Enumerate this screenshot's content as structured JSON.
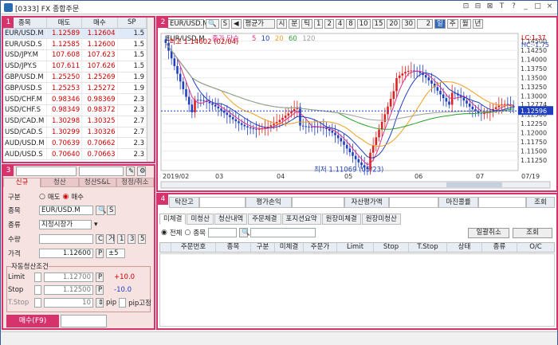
{
  "window": {
    "title": "[0333] FX 종합주문",
    "buttons": [
      "⊡",
      "⊟",
      "⊠",
      "T",
      "?",
      "_",
      "□",
      "×"
    ]
  },
  "panels": {
    "p1": "1",
    "p2": "2",
    "p3": "3",
    "p4": "4"
  },
  "quotes": {
    "headers": [
      "종목",
      "매도",
      "매수",
      "SP"
    ],
    "rows": [
      {
        "sym": "EUR/USD.M",
        "bid": "1.12589",
        "ask": "1.12604",
        "sp": "1.5"
      },
      {
        "sym": "EUR/USD.S",
        "bid": "1.12585",
        "ask": "1.12600",
        "sp": "1.5"
      },
      {
        "sym": "USD/JPY.M",
        "bid": "107.608",
        "ask": "107.623",
        "sp": "1.5"
      },
      {
        "sym": "USD/JPY.S",
        "bid": "107.611",
        "ask": "107.626",
        "sp": "1.5"
      },
      {
        "sym": "GBP/USD.M",
        "bid": "1.25250",
        "ask": "1.25269",
        "sp": "1.9"
      },
      {
        "sym": "GBP/USD.S",
        "bid": "1.25253",
        "ask": "1.25272",
        "sp": "1.9"
      },
      {
        "sym": "USD/CHF.M",
        "bid": "0.98346",
        "ask": "0.98369",
        "sp": "2.3"
      },
      {
        "sym": "USD/CHF.S",
        "bid": "0.98349",
        "ask": "0.98372",
        "sp": "2.3"
      },
      {
        "sym": "USD/CAD.M",
        "bid": "1.30298",
        "ask": "1.30325",
        "sp": "2.7"
      },
      {
        "sym": "USD/CAD.S",
        "bid": "1.30299",
        "ask": "1.30326",
        "sp": "2.7"
      },
      {
        "sym": "AUD/USD.M",
        "bid": "0.70639",
        "ask": "0.70662",
        "sp": "2.3"
      },
      {
        "sym": "AUD/USD.S",
        "bid": "0.70640",
        "ask": "0.70663",
        "sp": "2.3"
      }
    ]
  },
  "order": {
    "tabs": [
      "신규",
      "청산",
      "청산S&L",
      "정정/취소"
    ],
    "labels": {
      "side": "구분",
      "symbol": "종목",
      "type": "종류",
      "qty": "수량",
      "price": "가격",
      "auto": "자동청산조건",
      "limit": "Limit",
      "stop": "Stop",
      "tstop": "T.Stop",
      "pip": "pip",
      "pipfix": "pip고정"
    },
    "side_sell": "매도",
    "side_buy": "매수",
    "symbol": "EUR/USD.M",
    "s_btn": "S",
    "type": "지정시장가",
    "qty_btns": [
      "C",
      "거",
      "1",
      "3",
      "5"
    ],
    "price": "1.12600",
    "p_btn": "P",
    "tick": "±5",
    "limit": "1.12700",
    "limit_pips": "+10.0",
    "stop": "1.12500",
    "stop_pips": "-10.0",
    "tstop": "10",
    "submit": "매수(F9)"
  },
  "chart": {
    "toolbar": {
      "symbol": "EUR/USD.M",
      "s_btn": "S",
      "indicator": "평균가",
      "periods": [
        "시",
        "분",
        "틱"
      ],
      "nums": [
        "1",
        "2",
        "4",
        "8",
        "10",
        "15",
        "20",
        "30"
      ],
      "count": "2",
      "sel": "일",
      "week": "주",
      "month": "월",
      "year": "년"
    },
    "legend_symbol": "EUR/USD.M",
    "legend_ma": "종가 단순",
    "ma_periods": [
      "5",
      "10",
      "20",
      "60",
      "120"
    ],
    "ma_colors": [
      "#e0308a",
      "#1f3fbf",
      "#f0a020",
      "#2ca02c",
      "#a0a0a0"
    ],
    "annot_high": "최고 1.14602 (02/04)",
    "annot_low": "최저 1.11069 (05/23)",
    "lc": "LC:1.37",
    "hc": "HC:-1.75",
    "current": "1.12596",
    "y_ticks": [
      "1.14500",
      "1.14250",
      "1.14000",
      "1.13750",
      "1.13500",
      "1.13250",
      "1.13000",
      "1.12774",
      "1.12500",
      "1.12250",
      "1.12000",
      "1.11750",
      "1.11500",
      "1.11250"
    ],
    "x_labels": [
      "2019/02",
      "03",
      "04",
      "05",
      "06",
      "07",
      "07/19"
    ]
  },
  "chart_data": {
    "type": "candlestick",
    "title": "EUR/USD.M",
    "x_labels": [
      "2019/02",
      "03",
      "04",
      "05",
      "06",
      "07",
      "07/19"
    ],
    "ylim": [
      1.1097,
      1.1471
    ],
    "price_high": 1.14602,
    "price_high_date": "02/04",
    "price_low": 1.11069,
    "price_low_date": "05/23",
    "last": 1.12596,
    "series": [
      {
        "name": "5",
        "color": "#e0308a"
      },
      {
        "name": "10",
        "color": "#1f3fbf"
      },
      {
        "name": "20",
        "color": "#f0a020"
      },
      {
        "name": "60",
        "color": "#2ca02c"
      },
      {
        "name": "120",
        "color": "#a0a0a0"
      }
    ]
  },
  "account": {
    "headers": [
      "탁잔고",
      "평가손익",
      "자산평가액",
      "마진콜률"
    ],
    "values": [
      "",
      "",
      "",
      ""
    ],
    "inquiry": "조회"
  },
  "orders": {
    "tabs": [
      "미체결",
      "미청산",
      "청산내역",
      "주문체결",
      "포지션요약",
      "원장미체결",
      "원장미청산"
    ],
    "filter_all": "전체",
    "filter_sym": "종목",
    "cancel_all": "일괄취소",
    "inquiry": "조회",
    "headers": [
      "",
      "주문번호",
      "종목",
      "구분",
      "미체결",
      "주문가",
      "Limit",
      "Stop",
      "T.Stop",
      "상태",
      "종류",
      "O/C"
    ]
  }
}
